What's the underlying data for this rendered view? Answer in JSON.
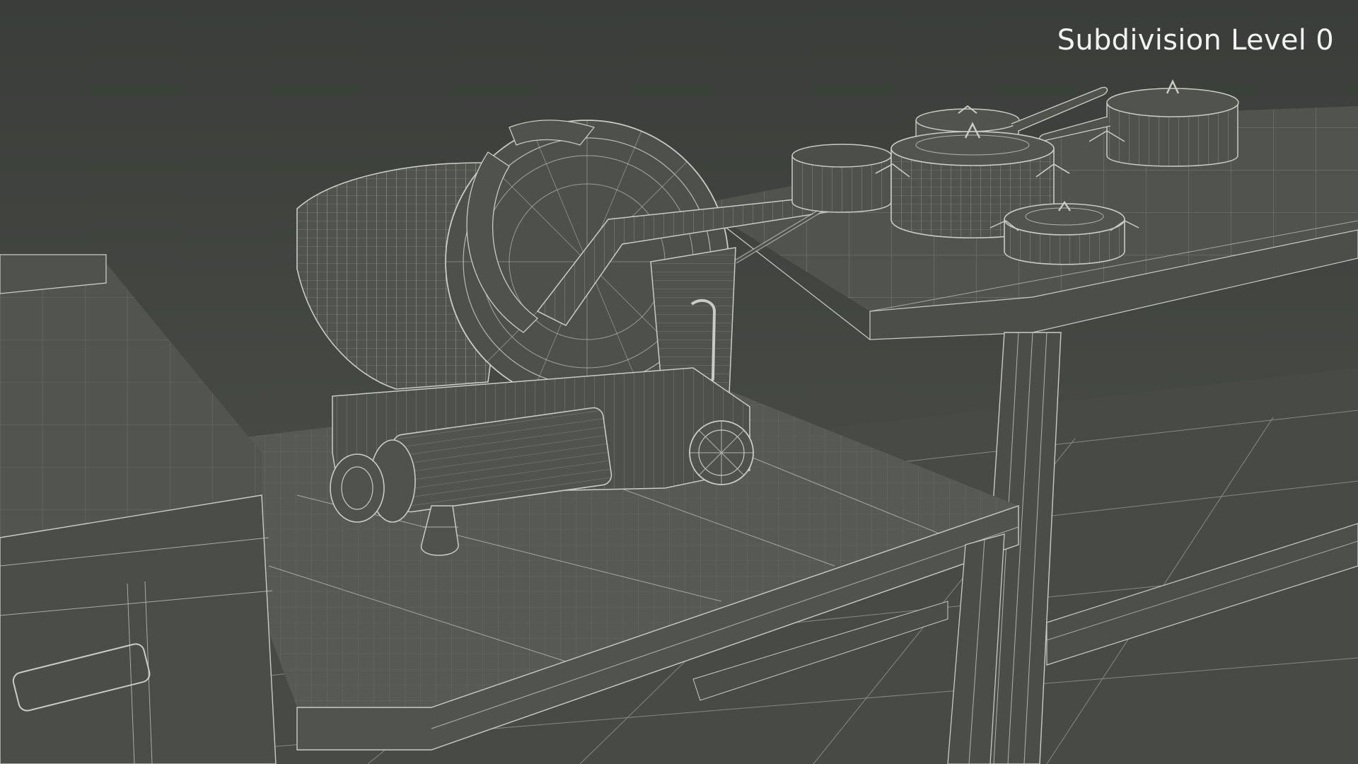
{
  "viewport": {
    "overlay_label": "Subdivision Level 0",
    "background_color": "#444742",
    "wire_color": "#c9ccc4",
    "surface_color": "#4f524d"
  },
  "scene": {
    "objects": [
      "meat-slicer",
      "stainless-steel-work-table",
      "upper-shelf-table",
      "lower-shelf",
      "cooking-pot-with-lid",
      "saucepan-with-lid",
      "open-pot",
      "small-casserole-with-lid",
      "large-pot-with-lid",
      "kitchen-cabinet"
    ]
  }
}
